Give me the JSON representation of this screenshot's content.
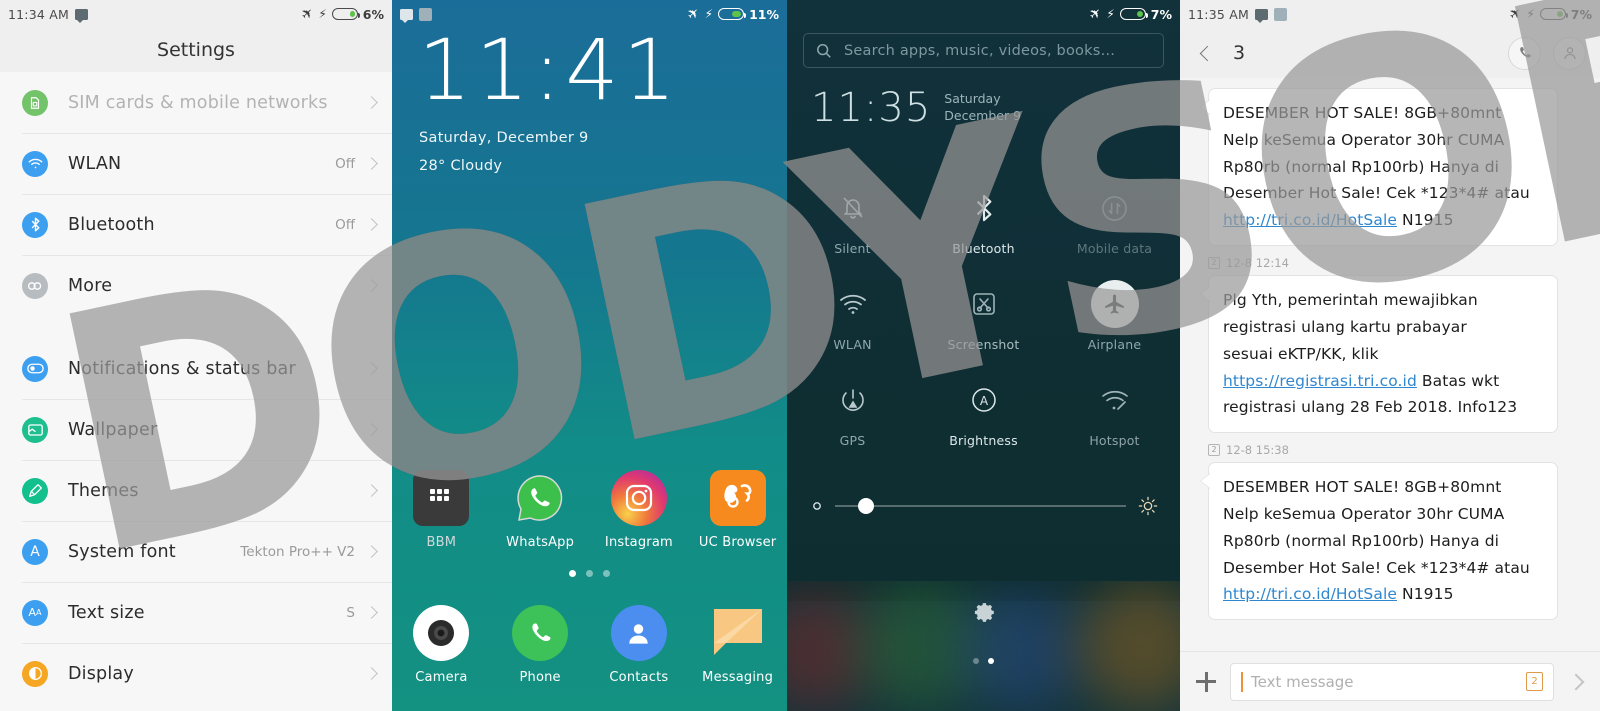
{
  "watermark": {
    "text": "DODYSOFT",
    "color": "#9a9a9a"
  },
  "panel_settings": {
    "status": {
      "time": "11:34 AM",
      "battery_percent": "6%",
      "airplane": "airplane-icon",
      "charging": "bolt-icon"
    },
    "title": "Settings",
    "items": [
      {
        "label": "SIM cards & mobile networks",
        "value": "",
        "icon": "sim-card-icon",
        "color": "#73c36a",
        "dimmed": true
      },
      {
        "label": "WLAN",
        "value": "Off",
        "icon": "wifi-icon",
        "color": "#3c9ff0",
        "dimmed": false
      },
      {
        "label": "Bluetooth",
        "value": "Off",
        "icon": "bluetooth-icon",
        "color": "#3c9ff0",
        "dimmed": false
      },
      {
        "label": "More",
        "value": "",
        "icon": "link-icon",
        "color": "#b7bcc0",
        "dimmed": false
      }
    ],
    "items2": [
      {
        "label": "Notifications & status bar",
        "value": "",
        "icon": "toggle-icon",
        "color": "#3c9ff0"
      },
      {
        "label": "Wallpaper",
        "value": "",
        "icon": "image-icon",
        "color": "#1dbf8e"
      },
      {
        "label": "Themes",
        "value": "",
        "icon": "brush-icon",
        "color": "#12c08d"
      },
      {
        "label": "System font",
        "value": "Tekton Pro++ V2",
        "icon": "font-a-icon",
        "color": "#3c9ff0"
      },
      {
        "label": "Text size",
        "value": "S",
        "icon": "text-size-icon",
        "color": "#3c9ff0"
      },
      {
        "label": "Display",
        "value": "",
        "icon": "brightness-icon",
        "color": "#f5a623"
      }
    ]
  },
  "panel_home": {
    "status": {
      "time": "",
      "battery_percent": "11%"
    },
    "clock": "11:41",
    "date": "Saturday, December 9",
    "weather": "28° Cloudy",
    "apps_row1": [
      {
        "name": "BBM",
        "icon": "bbm-icon",
        "dimmed": true
      },
      {
        "name": "WhatsApp",
        "icon": "whatsapp-icon",
        "dimmed": false
      },
      {
        "name": "Instagram",
        "icon": "instagram-icon",
        "dimmed": false
      },
      {
        "name": "UC Browser",
        "icon": "uc-browser-icon",
        "dimmed": false
      }
    ],
    "dock": [
      {
        "name": "Camera",
        "icon": "camera-icon"
      },
      {
        "name": "Phone",
        "icon": "phone-icon"
      },
      {
        "name": "Contacts",
        "icon": "contacts-icon"
      },
      {
        "name": "Messaging",
        "icon": "messaging-icon"
      }
    ],
    "page_dots": {
      "count": 3,
      "active": 0
    }
  },
  "panel_quick": {
    "status": {
      "battery_percent": "7%"
    },
    "search_placeholder": "Search apps, music, videos, books…",
    "clock": "11:35",
    "date_line1": "Saturday",
    "date_line2": "December 9",
    "tiles": [
      {
        "label": "Silent",
        "icon": "bell-off-icon",
        "active": false
      },
      {
        "label": "Bluetooth",
        "icon": "bluetooth-icon",
        "active": false
      },
      {
        "label": "Mobile data",
        "icon": "mobile-data-icon",
        "active": false
      },
      {
        "label": "WLAN",
        "icon": "wifi-icon",
        "active": false
      },
      {
        "label": "Screenshot",
        "icon": "scissors-icon",
        "active": false
      },
      {
        "label": "Airplane",
        "icon": "airplane-icon",
        "active": true
      },
      {
        "label": "GPS",
        "icon": "gps-icon",
        "active": false
      },
      {
        "label": "Brightness",
        "icon": "auto-brightness-icon",
        "active": false
      },
      {
        "label": "Hotspot",
        "icon": "hotspot-icon",
        "active": false
      }
    ],
    "brightness": {
      "value_percent": 8,
      "left_icon": "brightness-low-icon",
      "right_icon": "brightness-high-icon"
    },
    "gear": "gear-icon",
    "page_dots": {
      "count": 2,
      "active": 1
    }
  },
  "panel_sms": {
    "status": {
      "time": "11:35 AM",
      "battery_percent": "7%"
    },
    "header": {
      "back": "back-icon",
      "title": "3",
      "call": "call-icon",
      "contact": "contact-icon"
    },
    "messages": [
      {
        "stamp": "",
        "sim": "",
        "lines": [
          "DESEMBER HOT SALE! 8GB+80mnt",
          "Nelp keSemua Operator 30hr CUMA",
          "Rp80rb (normal Rp100rb) Hanya di",
          "Desember Hot Sale! Cek *123*4# atau"
        ],
        "link": "http://tri.co.id/HotSale",
        "tail": " N1915"
      },
      {
        "stamp": "12-8 12:14",
        "sim": "2",
        "lines": [
          "Plg Yth, pemerintah mewajibkan",
          "registrasi ulang kartu prabayar"
        ],
        "pre_link": "sesuai eKTP/KK, klik ",
        "link": "https://registrasi.tri.co.id",
        "tail": " Batas wkt",
        "post": "registrasi ulang 28 Feb 2018. Info123"
      },
      {
        "stamp": "12-8 15:38",
        "sim": "2",
        "lines": [
          "DESEMBER HOT SALE! 8GB+80mnt",
          "Nelp keSemua Operator 30hr CUMA",
          "Rp80rb (normal Rp100rb) Hanya di",
          "Desember Hot Sale! Cek *123*4# atau"
        ],
        "link": "http://tri.co.id/HotSale",
        "tail": " N1915"
      }
    ],
    "footer": {
      "add": "plus-icon",
      "placeholder": "Text message",
      "sim": "2",
      "send": "send-icon"
    }
  }
}
